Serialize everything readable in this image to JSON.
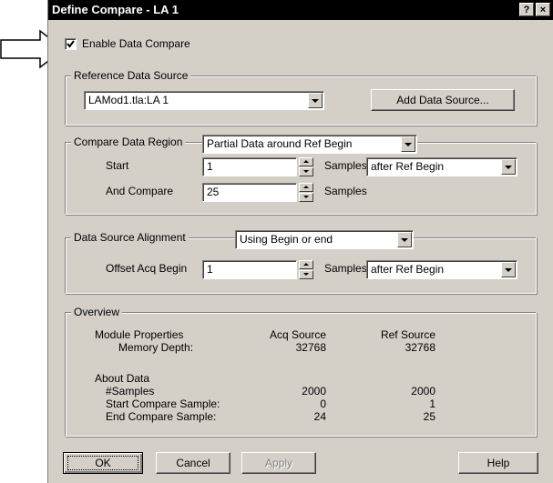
{
  "window": {
    "title": "Define Compare - LA 1",
    "help_btn": "?",
    "close_btn": "×"
  },
  "enable_compare": {
    "label": "Enable Data Compare",
    "checked": true
  },
  "reference": {
    "legend": "Reference Data Source",
    "source_value": "LAMod1.tla:LA 1",
    "add_button": "Add Data Source..."
  },
  "region": {
    "legend": "Compare Data Region",
    "mode_value": "Partial Data around Ref Begin",
    "start_label": "Start",
    "start_value": "1",
    "start_units": "Samples",
    "start_relation": "after Ref Begin",
    "and_compare_label": "And Compare",
    "and_compare_value": "25",
    "and_compare_units": "Samples"
  },
  "alignment": {
    "legend": "Data Source Alignment",
    "mode_value": "Using Begin or end",
    "offset_label": "Offset Acq Begin",
    "offset_value": "1",
    "offset_units": "Samples",
    "offset_relation": "after Ref Begin"
  },
  "overview": {
    "legend": "Overview",
    "module_properties": "Module Properties",
    "memory_depth": "Memory Depth:",
    "acq_header": "Acq Source",
    "ref_header": "Ref Source",
    "acq_memory": "32768",
    "ref_memory": "32768",
    "about_data": "About Data",
    "samples_label": "#Samples",
    "start_sample_label": "Start Compare Sample:",
    "end_sample_label": "End Compare Sample:",
    "acq_samples": "2000",
    "ref_samples": "2000",
    "acq_start": "0",
    "ref_start": "1",
    "acq_end": "24",
    "ref_end": "25"
  },
  "buttons": {
    "ok": "OK",
    "cancel": "Cancel",
    "apply": "Apply",
    "help": "Help"
  }
}
